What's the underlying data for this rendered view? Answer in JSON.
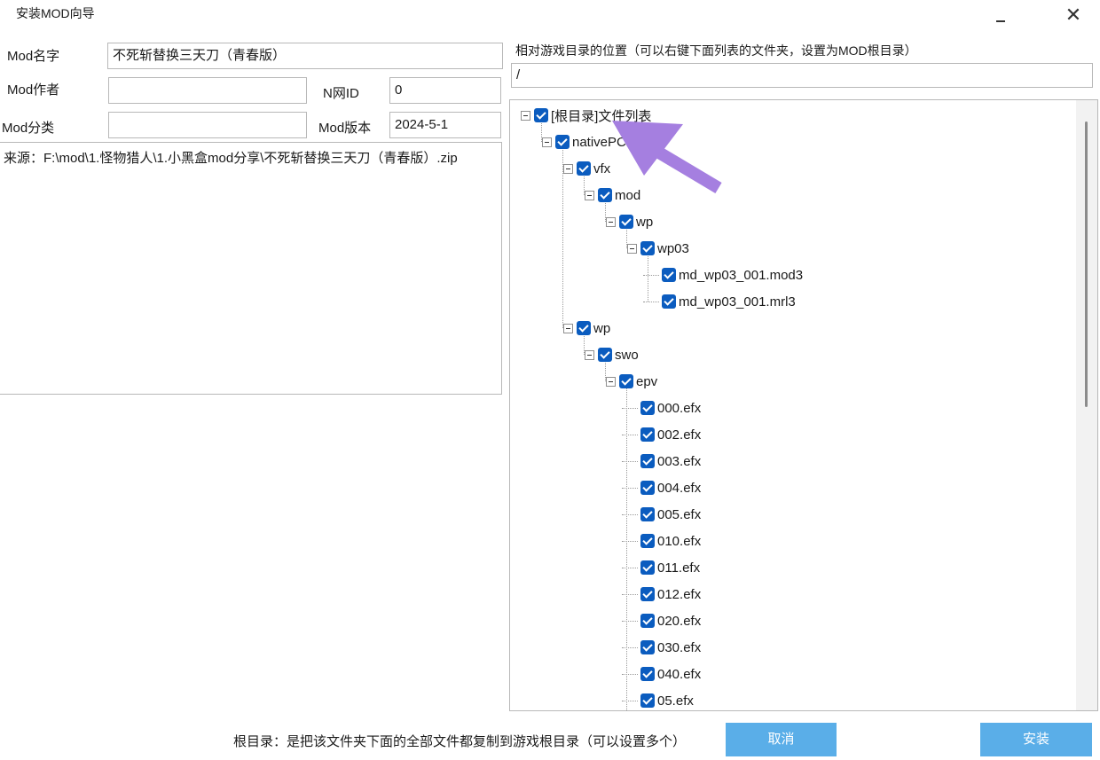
{
  "window": {
    "title": "安装MOD向导",
    "minimize_icon": "minimize-icon",
    "close_label": "✕"
  },
  "form": {
    "mod_name_label": "Mod名字",
    "mod_name_value": "不死斩替换三天刀（青春版）",
    "mod_author_label": "Mod作者",
    "mod_author_value": "",
    "nid_label": "N网ID",
    "nid_value": "0",
    "mod_category_label": "Mod分类",
    "mod_category_value": "",
    "mod_version_label": "Mod版本",
    "mod_version_value": "2024-5-1",
    "source_text": "来源：F:\\mod\\1.怪物猎人\\1.小黑盒mod分享\\不死斩替换三天刀（青春版）.zip"
  },
  "location": {
    "label": "相对游戏目录的位置（可以右键下面列表的文件夹，设置为MOD根目录）",
    "value": "/"
  },
  "tree": {
    "nodes": [
      {
        "label": "[根目录]文件列表",
        "checked": true,
        "expanded": true
      },
      {
        "label": "nativePC",
        "checked": true,
        "expanded": true
      },
      {
        "label": "vfx",
        "checked": true,
        "expanded": true
      },
      {
        "label": "mod",
        "checked": true,
        "expanded": true
      },
      {
        "label": "wp",
        "checked": true,
        "expanded": true
      },
      {
        "label": "wp03",
        "checked": true,
        "expanded": true
      },
      {
        "label": "md_wp03_001.mod3",
        "checked": true
      },
      {
        "label": "md_wp03_001.mrl3",
        "checked": true
      },
      {
        "label": "wp",
        "checked": true,
        "expanded": true
      },
      {
        "label": "swo",
        "checked": true,
        "expanded": true
      },
      {
        "label": "epv",
        "checked": true,
        "expanded": true
      },
      {
        "label": "000.efx",
        "checked": true
      },
      {
        "label": "002.efx",
        "checked": true
      },
      {
        "label": "003.efx",
        "checked": true
      },
      {
        "label": "004.efx",
        "checked": true
      },
      {
        "label": "005.efx",
        "checked": true
      },
      {
        "label": "010.efx",
        "checked": true
      },
      {
        "label": "011.efx",
        "checked": true
      },
      {
        "label": "012.efx",
        "checked": true
      },
      {
        "label": "020.efx",
        "checked": true
      },
      {
        "label": "030.efx",
        "checked": true
      },
      {
        "label": "040.efx",
        "checked": true
      },
      {
        "label": "05.efx",
        "checked": true
      }
    ]
  },
  "overlay": {
    "arrow_color": "#a57fe0"
  },
  "footer": {
    "note": "根目录：是把该文件夹下面的全部文件都复制到游戏根目录（可以设置多个）",
    "cancel_label": "取消",
    "install_label": "安装",
    "button_color": "#5aaee8",
    "checkbox_color": "#0b5cbf"
  }
}
